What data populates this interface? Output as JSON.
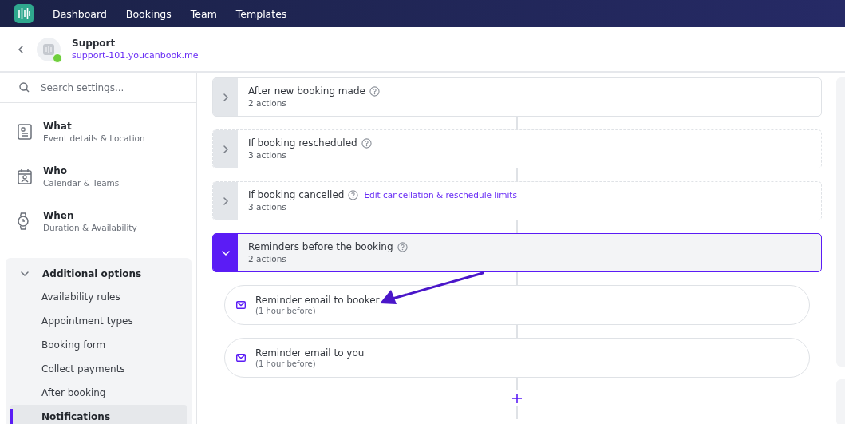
{
  "nav": {
    "items": [
      "Dashboard",
      "Bookings",
      "Team",
      "Templates"
    ]
  },
  "page_header": {
    "title": "Support",
    "url": "support-101.youcanbook.me",
    "online": true
  },
  "sidebar": {
    "search": {
      "placeholder": "Search settings..."
    },
    "sections": [
      {
        "title": "What",
        "subtitle": "Event details & Location",
        "kind": "details"
      },
      {
        "title": "Who",
        "subtitle": "Calendar & Teams",
        "kind": "people"
      },
      {
        "title": "When",
        "subtitle": "Duration & Availability",
        "kind": "time"
      }
    ],
    "group": {
      "title": "Additional options",
      "expanded": true,
      "items": [
        {
          "label": "Availability rules",
          "selected": false
        },
        {
          "label": "Appointment types",
          "selected": false
        },
        {
          "label": "Booking form",
          "selected": false
        },
        {
          "label": "Collect payments",
          "selected": false
        },
        {
          "label": "After booking",
          "selected": false
        },
        {
          "label": "Notifications",
          "selected": true
        }
      ]
    }
  },
  "workflows": [
    {
      "title": "After new booking made",
      "count": "2 actions",
      "kind": "solid",
      "expanded": false
    },
    {
      "title": "If booking rescheduled",
      "count": "3 actions",
      "kind": "dashed",
      "expanded": false
    },
    {
      "title": "If booking cancelled",
      "count": "3 actions",
      "kind": "dashed",
      "expanded": false,
      "link": "Edit cancellation & reschedule limits"
    },
    {
      "title": "Reminders before the booking",
      "count": "2 actions",
      "kind": "solid",
      "expanded": true,
      "actions": [
        {
          "title": "Reminder email to booker",
          "timing": "(1 hour before)"
        },
        {
          "title": "Reminder email to you",
          "timing": "(1 hour before)"
        }
      ]
    }
  ]
}
